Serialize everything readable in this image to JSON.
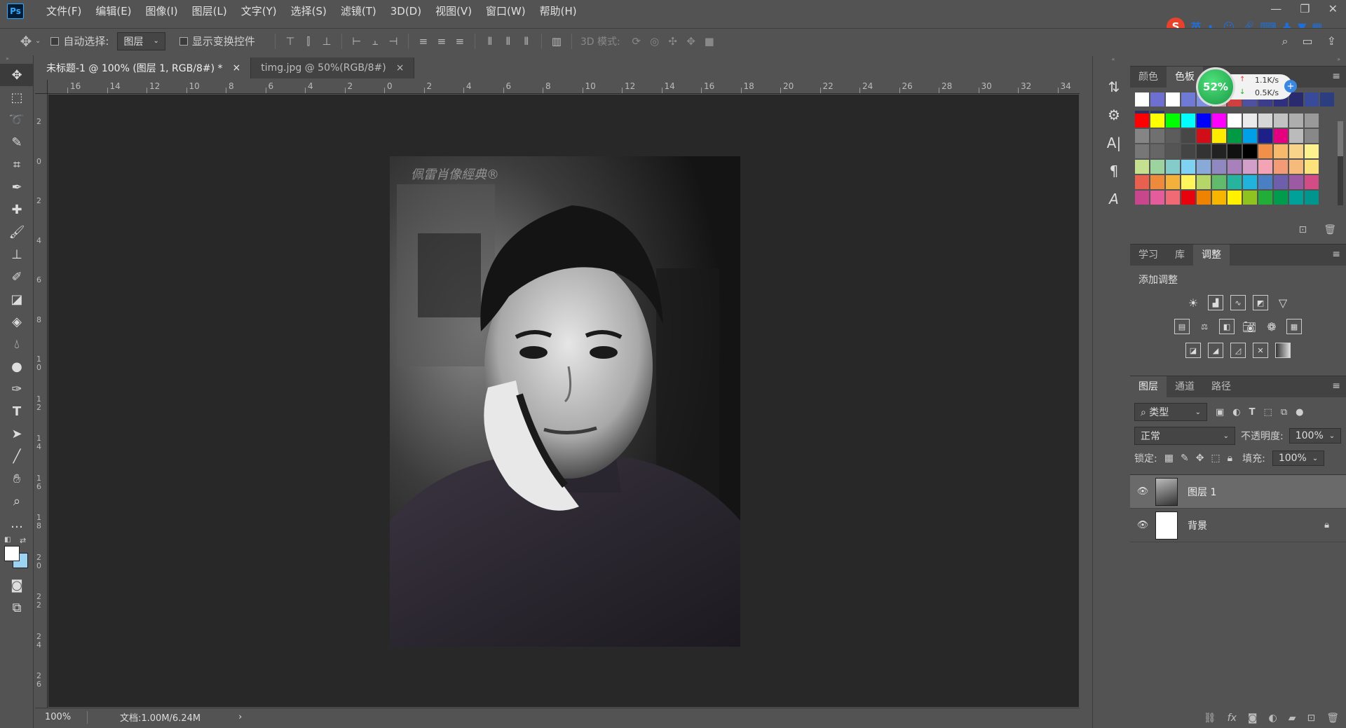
{
  "app": {
    "logo": "Ps"
  },
  "menu": [
    "文件(F)",
    "编辑(E)",
    "图像(I)",
    "图层(L)",
    "文字(Y)",
    "选择(S)",
    "滤镜(T)",
    "3D(D)",
    "视图(V)",
    "窗口(W)",
    "帮助(H)"
  ],
  "window_controls": [
    "—",
    "❐",
    "✕"
  ],
  "options": {
    "auto_select": "自动选择:",
    "auto_select_target": "图层",
    "show_transform": "显示变换控件",
    "mode_3d": "3D 模式:"
  },
  "tabs": [
    {
      "label": "未标题-1 @ 100% (图层 1, RGB/8#) *",
      "close": "×"
    },
    {
      "label": "timg.jpg @ 50%(RGB/8#)",
      "close": "×"
    }
  ],
  "ruler_h": [
    "16",
    "14",
    "12",
    "10",
    "8",
    "6",
    "4",
    "2",
    "0",
    "2",
    "4",
    "6",
    "8",
    "10",
    "12",
    "14",
    "16",
    "18",
    "20",
    "22",
    "24",
    "26",
    "28",
    "30",
    "32",
    "34"
  ],
  "ruler_v": [
    "2",
    "0",
    "2",
    "4",
    "6",
    "8",
    "10",
    "12",
    "14",
    "16",
    "18",
    "20",
    "22",
    "24",
    "26"
  ],
  "image": {
    "watermark": "佩雷肖像經典®"
  },
  "status": {
    "zoom": "100%",
    "doc": "文档:1.00M/6.24M",
    "arrow": "›"
  },
  "color_panel": {
    "tabs": [
      "颜色",
      "色板"
    ],
    "menu": "≡"
  },
  "adjust_panel": {
    "tabs": [
      "学习",
      "库",
      "调整"
    ],
    "title": "添加调整",
    "menu": "≡"
  },
  "layers_panel": {
    "tabs": [
      "图层",
      "通道",
      "路径"
    ],
    "menu": "≡",
    "filter": "类型",
    "blend": "正常",
    "opacity_label": "不透明度:",
    "opacity": "100%",
    "lock_label": "锁定:",
    "fill_label": "填充:",
    "fill": "100%",
    "layers": [
      {
        "name": "图层 1",
        "selected": true
      },
      {
        "name": "背景",
        "locked": true
      }
    ]
  },
  "network": {
    "percent": "52%",
    "up": "1.1K/s",
    "down": "0.5K/s"
  },
  "ime": {
    "mode": "英"
  },
  "colors": {
    "recent_swatches": [
      "#ffffff",
      "#6e6fd0",
      "#ffffff",
      "#6e7ad4",
      "#7f8fe0",
      "#c9a0a0",
      "#d04040",
      "#5050a0",
      "#3c3c8c",
      "#2f2f80",
      "#2a2a6e",
      "#3a4a9a",
      "#2c3e80",
      "#303060",
      "#2a3a6a"
    ],
    "swatches": [
      [
        "#ff0000",
        "#ffff00",
        "#00ff00",
        "#00ffff",
        "#0000ff",
        "#ff00ff",
        "#ffffff",
        "#ebebeb",
        "#d6d6d6",
        "#c2c2c2",
        "#adadad",
        "#999999"
      ],
      [
        "#858585",
        "#707070",
        "#5c5c5c",
        "#474747",
        "#d10d18",
        "#ffeb00",
        "#009944",
        "#00a0e9",
        "#1d2088",
        "#e4007f",
        "#bbbbbb",
        "#888888"
      ],
      [
        "#777777",
        "#666666",
        "#555555",
        "#444444",
        "#333333",
        "#222222",
        "#111111",
        "#000000",
        "#f19149",
        "#f7b96c",
        "#f8d38a",
        "#fcf28e"
      ],
      [
        "#c5e08e",
        "#9dd39f",
        "#84ccc9",
        "#80d2f3",
        "#89a9d9",
        "#8f88c1",
        "#a780bc",
        "#d19fc9",
        "#f3a3b4",
        "#f29b76",
        "#f6bb7b",
        "#fbe27b"
      ],
      [
        "#e8604e",
        "#ee8a3c",
        "#f3b13c",
        "#fff45c",
        "#b6d66a",
        "#62bb6b",
        "#27b49f",
        "#22b3dc",
        "#4a7fc3",
        "#6e5fac",
        "#9b5aa3",
        "#d34c85"
      ],
      [
        "#c8478c",
        "#e45c9c",
        "#ef6a74",
        "#e8020e",
        "#ef8200",
        "#f8b500",
        "#fff100",
        "#8fc31f",
        "#22ac38",
        "#009b4c",
        "#00a199",
        "#00958d"
      ]
    ]
  }
}
